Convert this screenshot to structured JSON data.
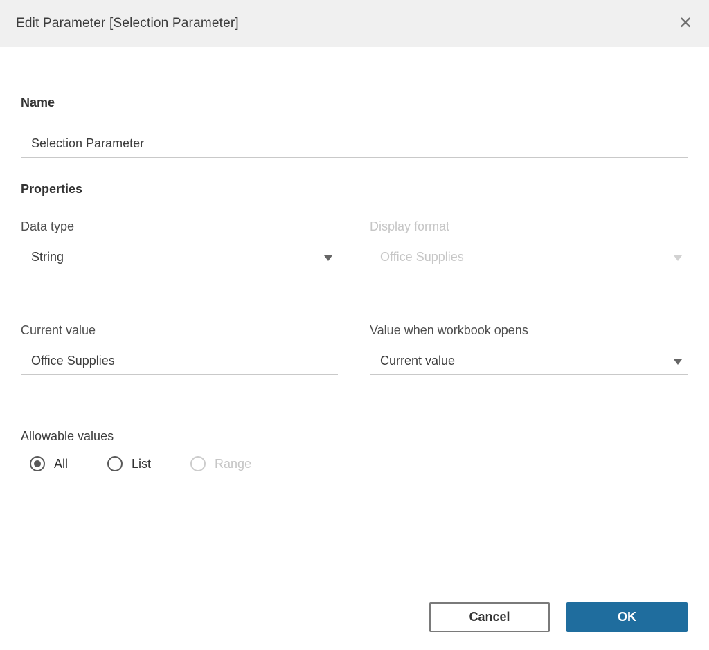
{
  "dialog": {
    "title": "Edit Parameter [Selection Parameter]",
    "close_glyph": "✕"
  },
  "name_section": {
    "label": "Name",
    "value": "Selection Parameter"
  },
  "properties": {
    "heading": "Properties",
    "data_type": {
      "label": "Data type",
      "value": "String"
    },
    "display_format": {
      "label": "Display format",
      "value": "Office Supplies",
      "state": "disabled"
    },
    "current_value": {
      "label": "Current value",
      "value": "Office Supplies"
    },
    "value_when_workbook_opens": {
      "label": "Value when workbook opens",
      "value": "Current value"
    }
  },
  "allowable_values": {
    "label": "Allowable values",
    "options": [
      {
        "label": "All",
        "selected": true,
        "disabled": false
      },
      {
        "label": "List",
        "selected": false,
        "disabled": false
      },
      {
        "label": "Range",
        "selected": false,
        "disabled": true
      }
    ]
  },
  "footer": {
    "cancel_label": "Cancel",
    "ok_label": "OK"
  },
  "colors": {
    "accent_blue": "#1f6d9e",
    "header_bg": "#f0f0f0",
    "text_dark": "#333333",
    "text_disabled": "#c6c6c6",
    "underline": "#c9c9c9"
  }
}
